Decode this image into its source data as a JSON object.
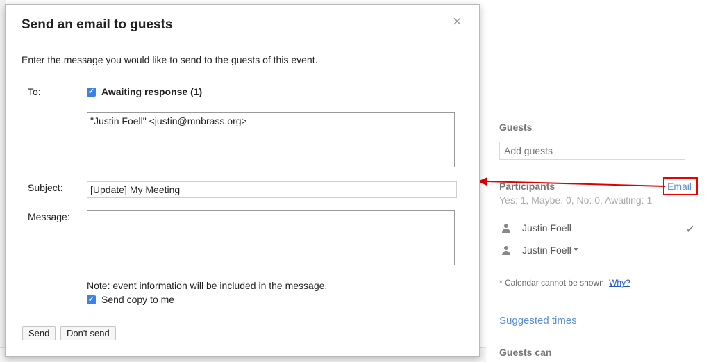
{
  "dialog": {
    "title": "Send an email to guests",
    "close_glyph": "×",
    "intro": "Enter the message you would like to send to the guests of this event.",
    "to_label": "To:",
    "awaiting_label": "Awaiting response (1)",
    "awaiting_checked": true,
    "recipients": "\"Justin Foell\" <justin@mnbrass.org>",
    "subject_label": "Subject:",
    "subject_value": "[Update] My Meeting",
    "message_label": "Message:",
    "message_value": "",
    "note": "Note: event information will be included in the message.",
    "copy_label": "Send copy to me",
    "copy_checked": true,
    "send_label": "Send",
    "dont_send_label": "Don't send"
  },
  "right_panel": {
    "guests_heading": "Guests",
    "add_guests_placeholder": "Add guests",
    "participants_heading": "Participants",
    "email_link": "Email",
    "counts": "Yes: 1, Maybe: 0, No: 0, Awaiting: 1",
    "participants": [
      {
        "name": "Justin Foell",
        "icon": "person-icon",
        "status_icon": "checkmark-icon"
      },
      {
        "name": "Justin Foell *",
        "icon": "person-icon",
        "status_icon": ""
      }
    ],
    "calendar_note": "* Calendar cannot be shown.",
    "why_link": "Why?",
    "suggested_times": "Suggested times",
    "guests_can_heading": "Guests can"
  },
  "colors": {
    "link": "#5b8fd6",
    "checkbox": "#3b82e6",
    "annotation": "#e00000"
  }
}
